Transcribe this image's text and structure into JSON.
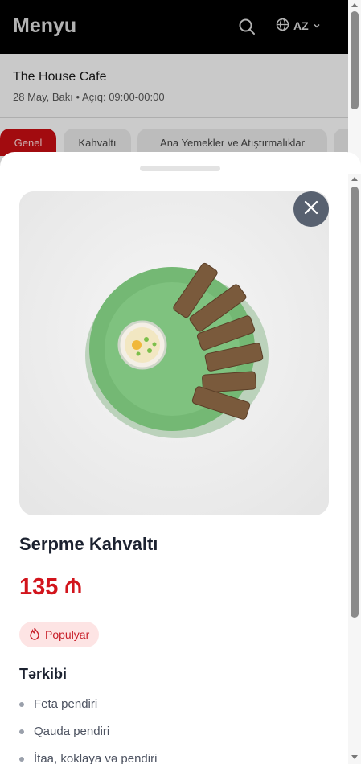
{
  "header": {
    "title": "Menyu",
    "lang": "AZ"
  },
  "venue": {
    "name": "The House Cafe",
    "meta": "28 May, Bakı • Açıq: 09:00-00:00"
  },
  "tabs": [
    {
      "label": "Genel"
    },
    {
      "label": "Kahvaltı"
    },
    {
      "label": "Ana Yemekler ve Atıştırmalıklar"
    }
  ],
  "dish": {
    "name": "Serpme Kahvaltı",
    "price": "135",
    "currency_icon": "manat-icon",
    "badge": "Populyar",
    "section_title": "Tərkibi",
    "ingredients": [
      "Feta pendiri",
      "Qauda pendiri",
      "İtaa, koklaya və pendiri"
    ]
  },
  "colors": {
    "accent": "#d2141c",
    "badge_bg": "#fde4e4",
    "close_bg": "#586170",
    "plate": "#74b874"
  }
}
